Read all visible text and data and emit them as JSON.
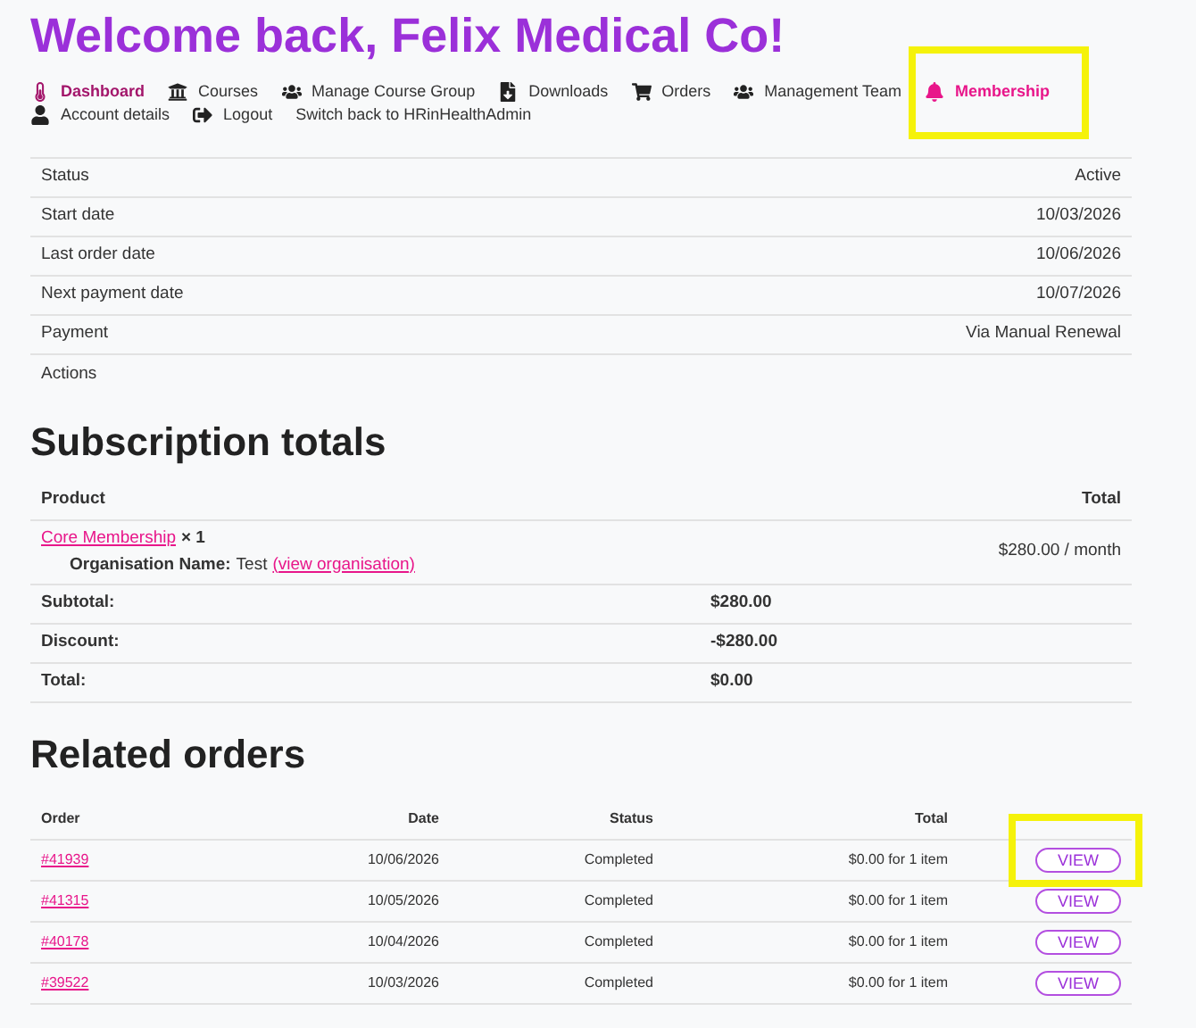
{
  "title": "Welcome back, Felix Medical Co!",
  "nav": [
    {
      "kind": "thermometer",
      "label": "Dashboard",
      "selected": true,
      "color": "#a3166b"
    },
    {
      "kind": "bank",
      "label": "Courses",
      "selected": false,
      "color": "#333333"
    },
    {
      "kind": "users",
      "label": "Manage Course Group",
      "selected": false,
      "color": "#333333"
    },
    {
      "kind": "file",
      "label": "Downloads",
      "selected": false,
      "color": "#333333"
    },
    {
      "kind": "cart",
      "label": "Orders",
      "selected": false,
      "color": "#333333"
    },
    {
      "kind": "users",
      "label": "Management Team",
      "selected": false,
      "color": "#333333"
    },
    {
      "kind": "bell",
      "label": "Membership",
      "selected": true,
      "color": "#e8168a"
    },
    {
      "kind": "user",
      "label": "Account details",
      "selected": false,
      "color": "#333333"
    },
    {
      "kind": "logout",
      "label": "Logout",
      "selected": false,
      "color": "#333333"
    },
    {
      "kind": "none",
      "label": "Switch back to HRinHealthAdmin",
      "selected": false,
      "color": "#333333"
    }
  ],
  "details": [
    {
      "label": "Status",
      "value": "Active"
    },
    {
      "label": "Start date",
      "value": "10/03/2026"
    },
    {
      "label": "Last order date",
      "value": "10/06/2026"
    },
    {
      "label": "Next payment date",
      "value": "10/07/2026"
    },
    {
      "label": "Payment",
      "value": "Via Manual Renewal"
    },
    {
      "label": "Actions"
    }
  ],
  "totals": {
    "heading": "Subscription totals",
    "columns": [
      "Product",
      "Total"
    ],
    "product": {
      "name": "Core Membership",
      "qty": "× 1",
      "meta_label": "Organisation Name:",
      "meta_value": "Test",
      "meta_link": "(view organisation)",
      "total": "$280.00 / month"
    },
    "rows": [
      {
        "label": "Subtotal:",
        "value": "$280.00"
      },
      {
        "label": "Discount:",
        "value": "-$280.00"
      },
      {
        "label": "Total:",
        "value": "$0.00"
      }
    ]
  },
  "orders": {
    "heading": "Related orders",
    "columns": [
      "Order",
      "Date",
      "Status",
      "Total"
    ],
    "rows": [
      {
        "order": "#41939",
        "date": "10/06/2026",
        "status": "Completed",
        "total": "$0.00 for 1 item",
        "action": "VIEW"
      },
      {
        "order": "#41315",
        "date": "10/05/2026",
        "status": "Completed",
        "total": "$0.00 for 1 item",
        "action": "VIEW"
      },
      {
        "order": "#40178",
        "date": "10/04/2026",
        "status": "Completed",
        "total": "$0.00 for 1 item",
        "action": "VIEW"
      },
      {
        "order": "#39522",
        "date": "10/03/2026",
        "status": "Completed",
        "total": "$0.00 for 1 item",
        "action": "VIEW"
      }
    ]
  }
}
